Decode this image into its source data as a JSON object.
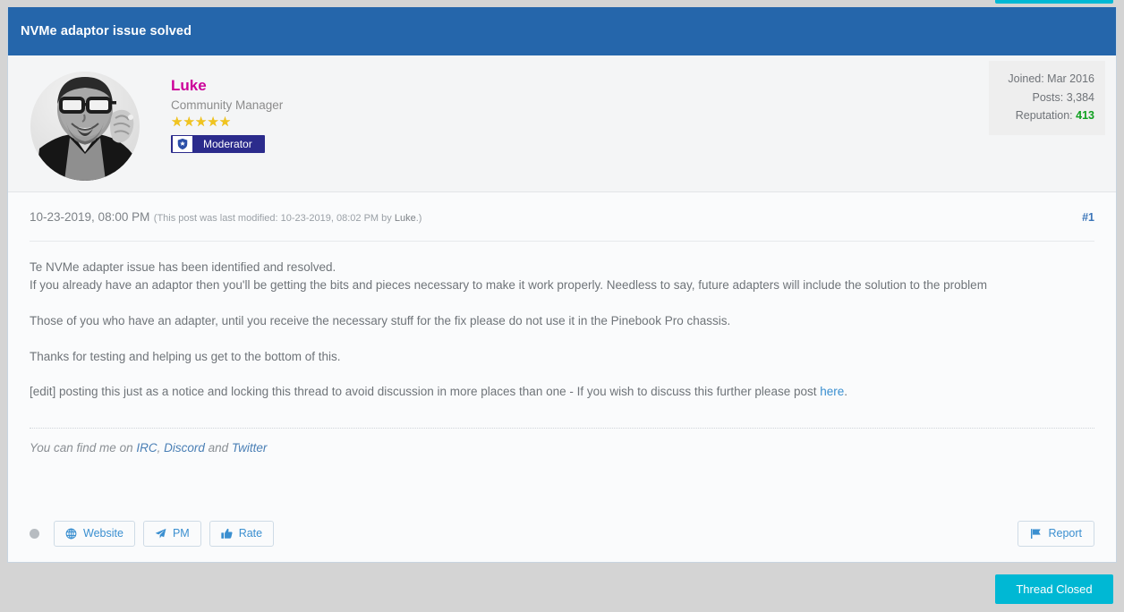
{
  "thread": {
    "title": "NVMe adaptor issue solved"
  },
  "author": {
    "name": "Luke",
    "user_title": "Community Manager",
    "stars": "★★★★★",
    "star_count": 5,
    "group_badge": {
      "label": "Moderator",
      "icon": "shield-star-icon"
    },
    "avatar_alt": "Luke avatar",
    "stats": {
      "joined_label": "Joined: Mar 2016",
      "posts_label": "Posts: 3,384",
      "reputation_label": "Reputation:",
      "reputation_value": "413"
    }
  },
  "post": {
    "date": "10-23-2019, 08:00 PM",
    "edit_note_prefix": "(This post was last modified: 10-23-2019, 08:02 PM by ",
    "edit_note_author": "Luke",
    "edit_note_suffix": ".)",
    "number": "#1",
    "paragraph_1_line_1": "Te NVMe adapter issue has been identified and resolved.",
    "paragraph_1_line_2": "If you already have an adaptor then you'll be getting the bits and pieces necessary to make it work properly. Needless to say, future adapters will include the solution to the problem",
    "paragraph_2": "Those of you who have an adapter, until you receive the necessary stuff for the fix please do not use it in the Pinebook Pro chassis.",
    "paragraph_3": "Thanks for testing and helping us get to the bottom of this.",
    "paragraph_4_before_link": "[edit] posting this just as a notice and locking this thread to avoid discussion in more places than one - If you wish to discuss this further please post ",
    "paragraph_4_link": "here",
    "paragraph_4_after_link": "."
  },
  "signature": {
    "prefix": "You can find me on ",
    "link_irc": "IRC",
    "sep_1": ", ",
    "link_discord": "Discord",
    "sep_2": " and ",
    "link_twitter": "Twitter"
  },
  "controls": {
    "website_label": "Website",
    "pm_label": "PM",
    "rate_label": "Rate",
    "report_label": "Report",
    "website_icon": "globe-icon",
    "pm_icon": "paper-plane-icon",
    "rate_icon": "thumbs-up-icon",
    "report_icon": "flag-icon",
    "online_status_icon": "offline-dot-icon"
  },
  "footer": {
    "thread_closed_label": "Thread Closed"
  },
  "colors": {
    "header_blue": "#2566ab",
    "username_pink": "#cc0099",
    "reputation_green": "#10a020",
    "link_blue": "#3a8fd0",
    "thread_closed_cyan": "#00b8d4",
    "badge_navy": "#2b2b8c",
    "star_yellow": "#f0c420",
    "page_gray": "#d4d4d4"
  }
}
